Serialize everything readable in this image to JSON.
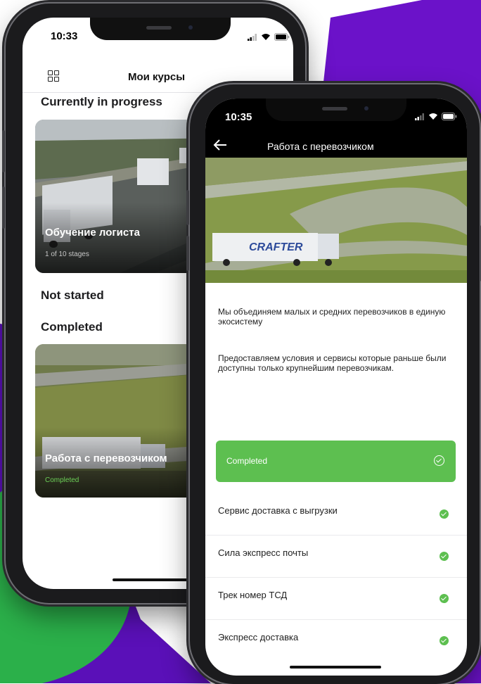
{
  "colors": {
    "purple": "#6b12c9",
    "green": "#2bb04a",
    "completed_green": "#5dbf50",
    "phone_frame": "#1b1b1d"
  },
  "phone1": {
    "status": {
      "time": "10:33"
    },
    "header": {
      "title": "Мои курсы",
      "menu_icon": "grid-icon"
    },
    "sections": {
      "in_progress": "Currently in progress",
      "not_started": "Not started",
      "completed": "Completed"
    },
    "cards": [
      {
        "title": "Обучение логиста",
        "subtitle": "1 of 10 stages"
      },
      {
        "title": "Работа с перевозчиком",
        "subtitle": "Completed"
      }
    ]
  },
  "phone2": {
    "status": {
      "time": "10:35"
    },
    "header": {
      "title": "Работа с перевозчиком",
      "back_icon": "back-arrow-icon"
    },
    "hero": {
      "truck_brand": "CRAFTER"
    },
    "description": [
      "Мы объединяем малых и средних перевозчиков в единую экосистему",
      "Предоставляем условия и сервисы которые раньше были доступны только крупнейшим перевозчикам."
    ],
    "status_bar": {
      "label": "Completed"
    },
    "lessons": [
      {
        "label": "Сервис доставка с выгрузки"
      },
      {
        "label": "Сила экспресс почты"
      },
      {
        "label": "Трек номер ТСД"
      },
      {
        "label": "Экспресс доставка"
      }
    ]
  }
}
